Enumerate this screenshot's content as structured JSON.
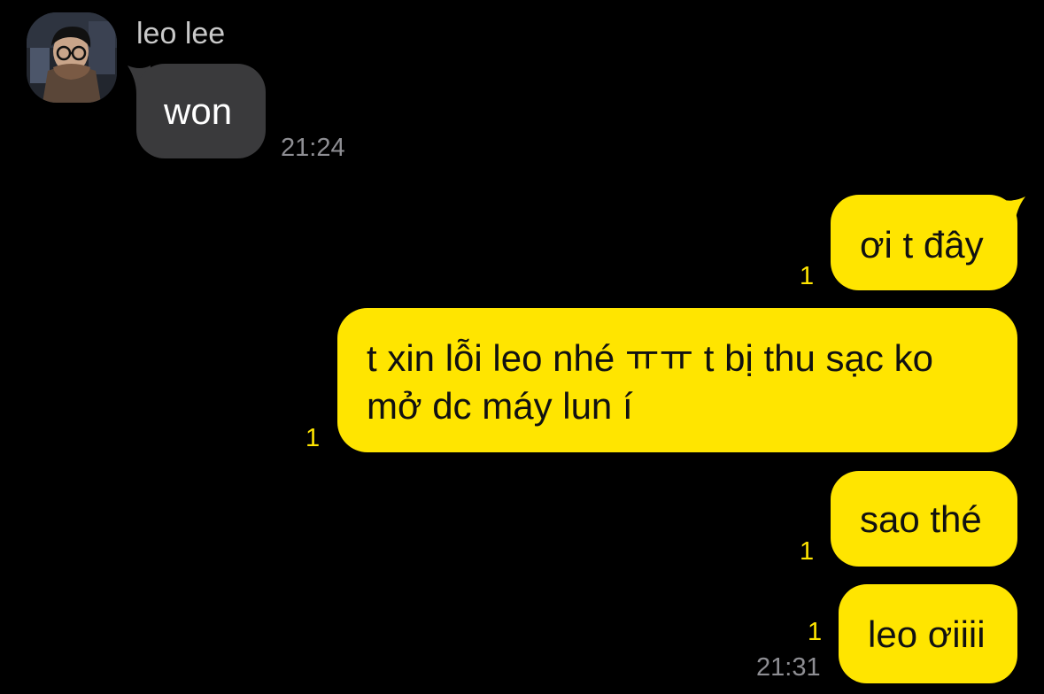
{
  "conversation": {
    "contact_name": "leo lee",
    "avatar_icon": "profile-photo",
    "colors": {
      "background": "#000000",
      "incoming_bubble": "#3a3a3c",
      "outgoing_bubble": "#ffe500",
      "unread_count": "#ffe500",
      "timestamp": "#8e8e93"
    }
  },
  "messages": [
    {
      "direction": "incoming",
      "text": "won",
      "time": "21:24"
    },
    {
      "direction": "outgoing",
      "text": "ơi t đây",
      "unread": "1"
    },
    {
      "direction": "outgoing",
      "text": "t xin lỗi leo nhé ㅠㅠ t bị thu sạc ko mở dc máy lun í",
      "unread": "1"
    },
    {
      "direction": "outgoing",
      "text": "sao thé",
      "unread": "1"
    },
    {
      "direction": "outgoing",
      "text": "leo ơiiii",
      "unread": "1",
      "time": "21:31"
    }
  ]
}
